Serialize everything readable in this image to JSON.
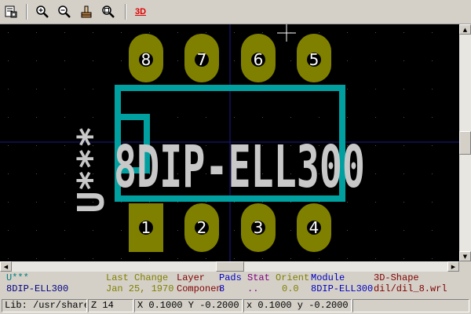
{
  "toolbar": {
    "icons": [
      "module-properties-icon",
      "zoom-in-icon",
      "zoom-out-icon",
      "redraw-icon",
      "zoom-fit-icon"
    ],
    "view3d_label": "3D"
  },
  "canvas": {
    "background": "#000000",
    "pad_color": "#808000",
    "outline_color": "#00a0a0",
    "text_color": "#c8c8c8",
    "module_value": "8DIP-ELL300",
    "reference": "U***",
    "pads_top": [
      "8",
      "7",
      "6",
      "5"
    ],
    "pads_bottom": [
      "1",
      "2",
      "3",
      "4"
    ]
  },
  "message_panel": {
    "columns": [
      {
        "header": "U***",
        "value": "8DIP-ELL300",
        "header_color": "#008080",
        "value_color": "#000080"
      },
      {
        "header": "Last Change",
        "value": "Jan 25, 1970",
        "header_color": "#808000",
        "value_color": "#808000"
      },
      {
        "header": "Layer",
        "value": "Componen",
        "header_color": "#800000",
        "value_color": "#800000"
      },
      {
        "header": "Pads",
        "value": "8",
        "header_color": "#0000c0",
        "value_color": "#0000c0"
      },
      {
        "header": "Stat",
        "value": "..",
        "header_color": "#800080",
        "value_color": "#800080"
      },
      {
        "header": "Orient",
        "value": "0.0",
        "header_color": "#808000",
        "value_color": "#808000"
      },
      {
        "header": "Module",
        "value": "8DIP-ELL300",
        "header_color": "#0000c0",
        "value_color": "#0000c0"
      },
      {
        "header": "3D-Shape",
        "value": "dil/dil_8.wrl",
        "header_color": "#800000",
        "value_color": "#800000"
      }
    ]
  },
  "status": {
    "lib": "Lib: /usr/share",
    "zoom": "Z 14",
    "abs_coords": "X 0.1000  Y -0.2000",
    "rel_coords": "x 0.1000  y -0.2000"
  }
}
